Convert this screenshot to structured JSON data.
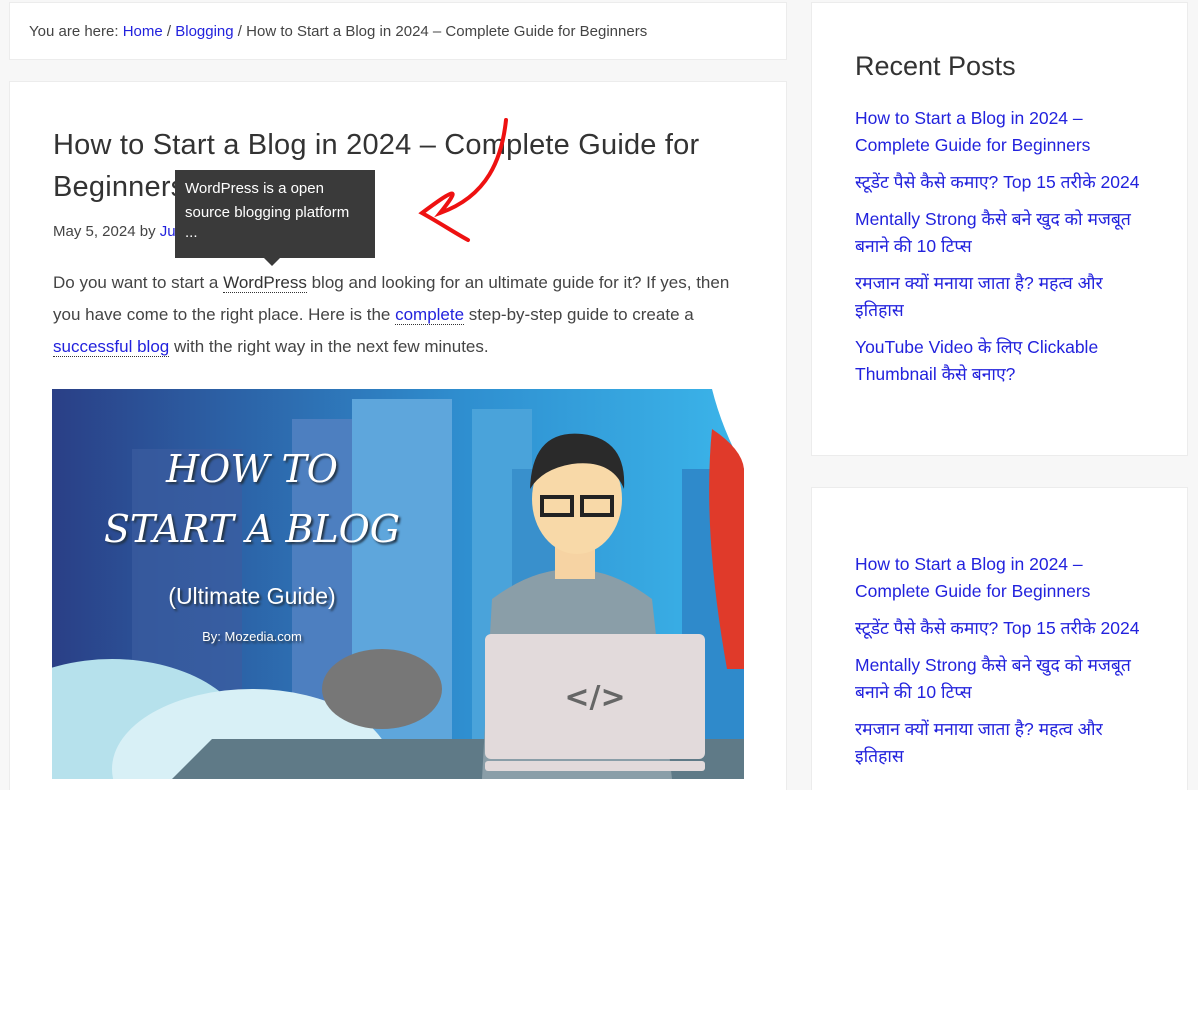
{
  "breadcrumb": {
    "prefix": "You are here:",
    "items": [
      {
        "label": "Home"
      },
      {
        "label": "Blogging"
      }
    ],
    "sep": "/",
    "current": "How to Start a Blog in 2024 – Complete Guide for Beginners"
  },
  "article": {
    "title": "How to Start a Blog in 2024 – Complete Guide for Beginners",
    "date": "May 5, 2024",
    "by": "by",
    "author": "Ju",
    "intro": {
      "p1": "Do you want to start a ",
      "l1": "WordPress",
      "p2": " blog and looking for an ultimate guide for it? If yes, then you have come to the right place. Here is the ",
      "l2": "complete",
      "p3": " step-by-step guide to create a ",
      "l3": "successful blog",
      "p4": " with the right way in the next few minutes."
    },
    "tooltip": {
      "line1": "WordPress is a open",
      "line2": "source blogging platform",
      "more": "..."
    },
    "hero": {
      "line1": "HOW TO",
      "line2": "START A BLOG",
      "line3": "(Ultimate Guide)",
      "line4": "By: Mozedia.com"
    }
  },
  "sidebar": {
    "recent_title": "Recent Posts",
    "posts": [
      {
        "label": "How to Start a Blog in 2024 – Complete Guide for Beginners"
      },
      {
        "label": "स्टूडेंट पैसे कैसे कमाए? Top 15 तरीके 2024"
      },
      {
        "label": "Mentally Strong कैसे बने खुद को मजबूत बनाने की 10 टिप्स"
      },
      {
        "label": "रमजान क्यों मनाया जाता है? महत्व और इतिहास"
      },
      {
        "label": "YouTube Video के लिए Clickable Thumbnail कैसे बनाए?"
      }
    ],
    "posts2": [
      {
        "label": "How to Start a Blog in 2024 – Complete Guide for Beginners"
      },
      {
        "label": "स्टूडेंट पैसे कैसे कमाए? Top 15 तरीके 2024"
      },
      {
        "label": "Mentally Strong कैसे बने खुद को मजबूत बनाने की 10 टिप्स"
      },
      {
        "label": "रमजान क्यों मनाया जाता है? महत्व और इतिहास"
      }
    ]
  },
  "colors": {
    "link": "#2222dd",
    "tooltip_bg": "#3a3a3a",
    "annotation_arrow": "#ee1111"
  }
}
